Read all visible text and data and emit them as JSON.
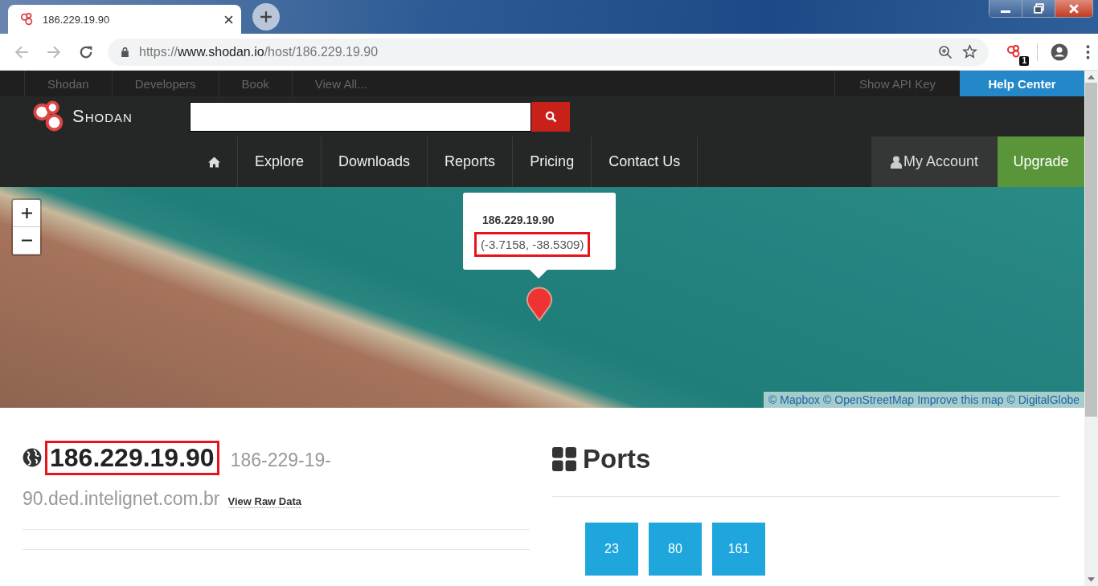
{
  "browser": {
    "tab": {
      "title": "186.229.19.90",
      "selected": true
    },
    "url": {
      "scheme": "https://",
      "domain": "www.shodan.io",
      "path": "/host/186.229.19.90"
    },
    "extension_badge": "1"
  },
  "top_nav": {
    "left": [
      "Shodan",
      "Developers",
      "Book",
      "View All..."
    ],
    "right": [
      {
        "label": "Show API Key",
        "kind": "link"
      },
      {
        "label": "Help Center",
        "kind": "button"
      }
    ]
  },
  "header": {
    "logo": "Shodan",
    "nav": [
      "Explore",
      "Downloads",
      "Reports",
      "Pricing",
      "Contact Us"
    ],
    "account": "My Account",
    "upgrade": "Upgrade"
  },
  "map": {
    "popup": {
      "title": "186.229.19.90",
      "coords": "(-3.7158, -38.5309)",
      "highlighted": true
    },
    "attribution": [
      "© Mapbox",
      "© OpenStreetMap",
      "Improve this map",
      "© DigitalGlobe"
    ]
  },
  "host": {
    "ip": "186.229.19.90",
    "highlighted": true,
    "hostname_lines": [
      "186-229-19-",
      "90.ded.intelignet.com.br"
    ],
    "raw_link": "View Raw Data"
  },
  "ports": {
    "title": "Ports",
    "items": [
      "23",
      "80",
      "161"
    ]
  }
}
